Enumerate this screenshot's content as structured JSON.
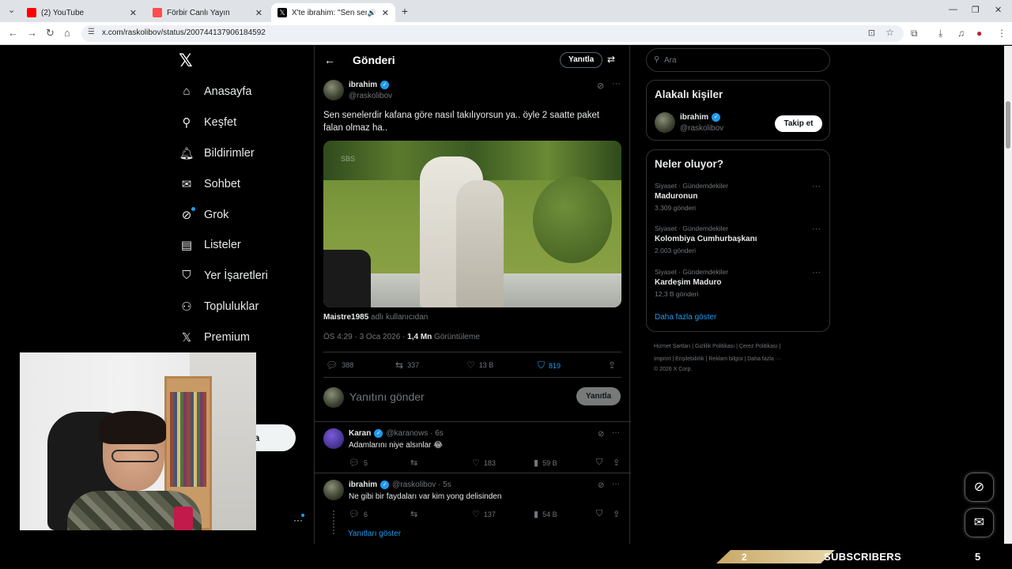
{
  "browser": {
    "tabs": [
      {
        "label": "(2) YouTube",
        "color": "#ff0000"
      },
      {
        "label": "Förbir Canlı Yayın",
        "color": "#ff4d4d"
      },
      {
        "label": "X'te ibrahim: \"Sen senelerdi",
        "color": "#000000"
      }
    ],
    "url": "x.com/raskolibov/status/2007441379061845 92"
  },
  "nav": {
    "items": [
      "Anasayfa",
      "Keşfet",
      "Bildirimler",
      "Sohbet",
      "Grok",
      "Listeler",
      "Yer İşaretleri",
      "Topluluklar",
      "Premium"
    ],
    "post_button_partial": "nla"
  },
  "header": {
    "title": "Gönderi",
    "reply_label": "Yanıtla"
  },
  "tweet": {
    "author": "ibrahim",
    "handle": "@raskolibov",
    "text": "Sen senelerdir kafana göre nasıl takılıyorsun ya.. öyle 2 saatte paket falan olmaz ha..",
    "media_watermark": "SBS",
    "community_user": "Maistre1985",
    "community_suffix": "adlı kullanıcıdan",
    "time": "ÖS 4:29 · 3 Oca 2026 ·",
    "views": "1,4 Mn",
    "views_label": "Görüntüleme",
    "replies": "388",
    "reposts": "337",
    "likes": "13 B",
    "bookmarks": "819"
  },
  "composer": {
    "placeholder": "Yanıtını gönder",
    "button": "Yanıtla"
  },
  "replies": [
    {
      "author": "Karan",
      "handle": "@karanows · 6s",
      "text": "Adamlarını niye alsınlar 😂",
      "replies": "5",
      "likes": "183",
      "views": "59 B"
    },
    {
      "author": "ibrahim",
      "handle": "@raskolibov · 5s",
      "text": "Ne gibi bir faydaları var kim yong delisinden",
      "replies": "6",
      "likes": "137",
      "views": "54 B"
    }
  ],
  "show_replies": "Yanıtları göster",
  "right": {
    "search_placeholder": "Ara",
    "relevant_title": "Alakalı kişiler",
    "relevant_name": "ibrahim",
    "relevant_handle": "@raskolibov",
    "follow_label": "Takip et",
    "trends_title": "Neler oluyor?",
    "trends": [
      {
        "category": "Siyaset · Gündemdekiler",
        "name": "Maduronun",
        "count": "3.309 gönderi"
      },
      {
        "category": "Siyaset · Gündemdekiler",
        "name": "Kolombiya Cumhurbaşkanı",
        "count": "2.003 gönderi"
      },
      {
        "category": "Siyaset · Gündemdekiler",
        "name": "Kardeşim Maduro",
        "count": "12,3 B gönderi"
      }
    ],
    "show_more": "Daha fazla göster",
    "footer_line1": "Hizmet Şartları  |  Gizlilik Politikası  |  Çerez Politikası  |",
    "footer_line2": "Imprint  |  Erişilebilirlik  |  Reklam bilgisi  |  Daha fazla ···",
    "footer_line3": "© 2026 X Corp."
  },
  "overlay": {
    "sub_count": "2",
    "sub_label": "SUBSCRIBERS",
    "sub_right": "5"
  }
}
